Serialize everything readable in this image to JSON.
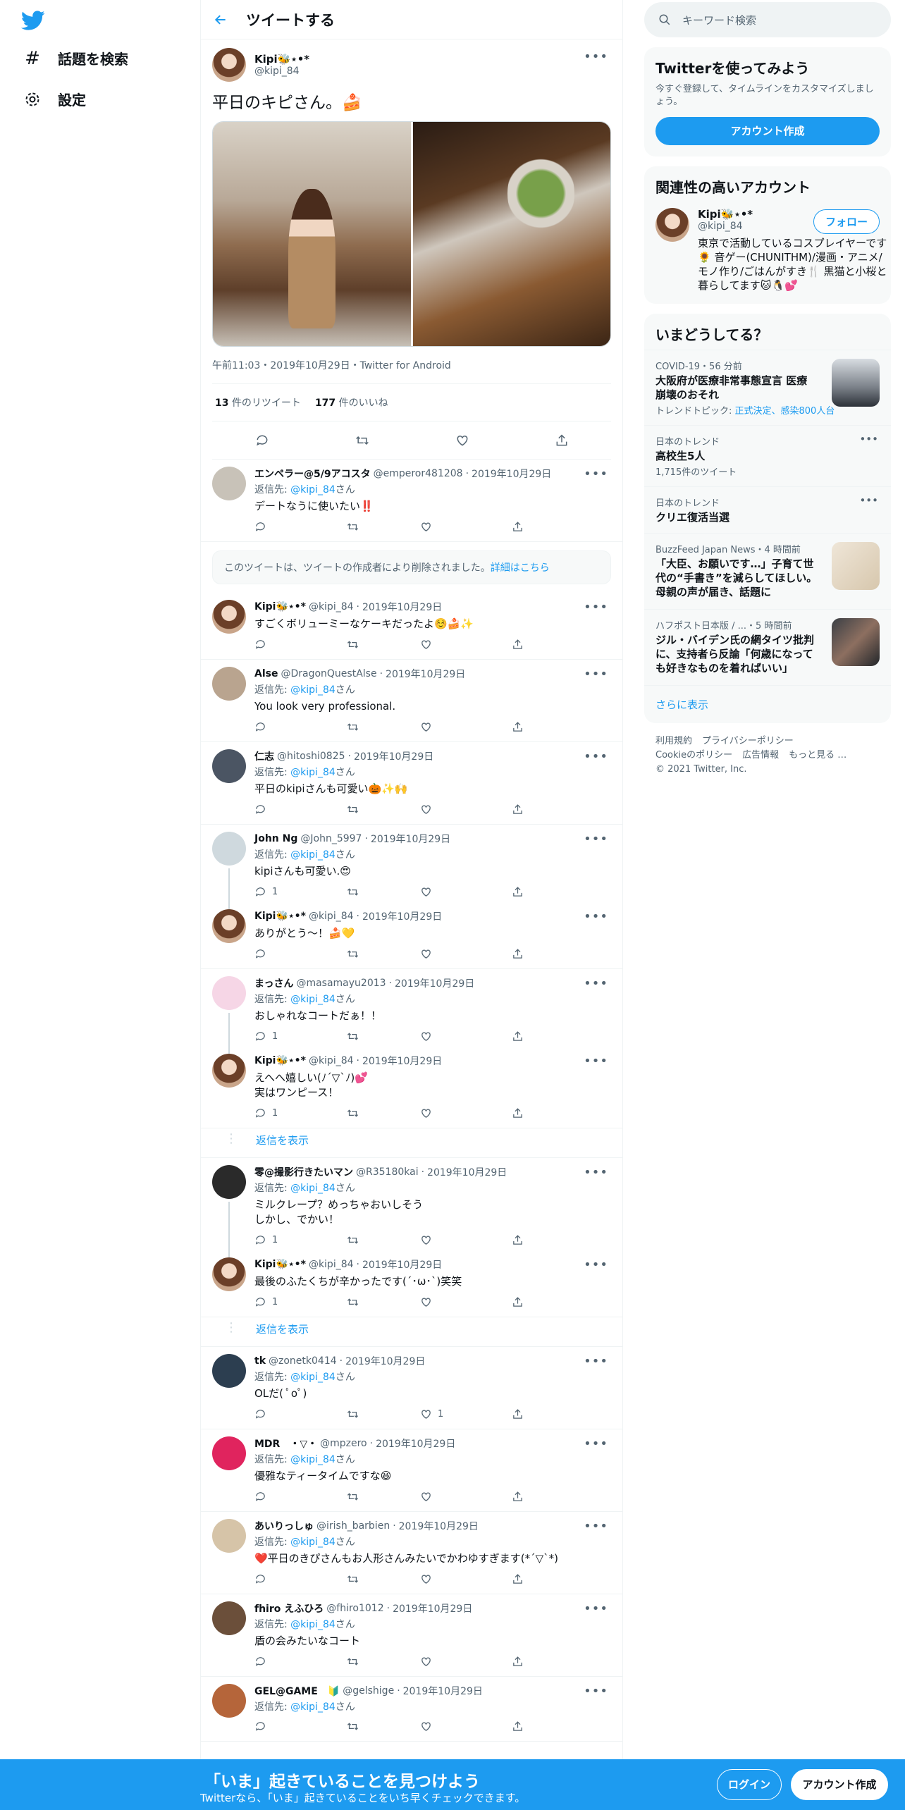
{
  "nav": {
    "explore_label": "話題を検索",
    "settings_label": "設定"
  },
  "header": {
    "title": "ツイートする"
  },
  "focal": {
    "name": "Kipi🐝⋆•*",
    "handle": "@kipi_84",
    "text": "平日のキピさん。🍰",
    "meta": "午前11:03・2019年10月29日・Twitter for Android",
    "retweets": "13",
    "retweets_label": "件のリツイート",
    "likes": "177",
    "likes_label": "件のいいね"
  },
  "deleted_notice": {
    "text": "このツイートは、ツイートの作成者により削除されました。",
    "link": "詳細はこちら"
  },
  "reply_to_label": "返信先:",
  "reply_to_suffix": "さん",
  "show_replies_label": "返信を表示",
  "replies": [
    {
      "name": "エンペラー@5/9アコスタ",
      "handle": "@emperor481208",
      "date": "2019年10月29日",
      "to": "@kipi_84",
      "text": "デートなうに使いたい‼️",
      "reply_count": "",
      "like_count": ""
    },
    {
      "name": "Kipi🐝⋆•*",
      "handle": "@kipi_84",
      "date": "2019年10月29日",
      "to": "",
      "text": "すごくボリューミーなケーキだったよ☺️🍰✨",
      "reply_count": "",
      "like_count": ""
    },
    {
      "name": "Alse",
      "handle": "@DragonQuestAlse",
      "date": "2019年10月29日",
      "to": "@kipi_84",
      "text": "You look very professional.",
      "reply_count": "",
      "like_count": ""
    },
    {
      "name": "仁志",
      "handle": "@hitoshi0825",
      "date": "2019年10月29日",
      "to": "@kipi_84",
      "text": "平日のkipiさんも可愛い🎃✨🙌",
      "reply_count": "",
      "like_count": ""
    },
    {
      "name": "John Ng",
      "handle": "@John_5997",
      "date": "2019年10月29日",
      "to": "@kipi_84",
      "text": "kipiさんも可愛い.😍",
      "reply_count": "1",
      "like_count": ""
    },
    {
      "name": "Kipi🐝⋆•*",
      "handle": "@kipi_84",
      "date": "2019年10月29日",
      "to": "",
      "text": "ありがとう〜！🍰💛",
      "reply_count": "",
      "like_count": ""
    },
    {
      "name": "まっさん",
      "handle": "@masamayu2013",
      "date": "2019年10月29日",
      "to": "@kipi_84",
      "text": "おしゃれなコートだぁ！！",
      "reply_count": "1",
      "like_count": ""
    },
    {
      "name": "Kipi🐝⋆•*",
      "handle": "@kipi_84",
      "date": "2019年10月29日",
      "to": "",
      "text": "えへへ嬉しい(ﾉ´▽`ﾉ)💕\n実はワンピース！",
      "reply_count": "1",
      "like_count": ""
    },
    {
      "name": "零@撮影行きたいマン",
      "handle": "@R35180kai",
      "date": "2019年10月29日",
      "to": "@kipi_84",
      "text": "ミルクレープ？めっちゃおいしそう\nしかし、でかい！",
      "reply_count": "1",
      "like_count": ""
    },
    {
      "name": "Kipi🐝⋆•*",
      "handle": "@kipi_84",
      "date": "2019年10月29日",
      "to": "",
      "text": "最後のふたくちが辛かったです(´･ω･`)笑笑",
      "reply_count": "1",
      "like_count": ""
    },
    {
      "name": "tk",
      "handle": "@zonetk0414",
      "date": "2019年10月29日",
      "to": "@kipi_84",
      "text": "OLだ( ﾟoﾟ)",
      "reply_count": "",
      "like_count": "1"
    },
    {
      "name": "MDR　・▽・",
      "handle": "@mpzero",
      "date": "2019年10月29日",
      "to": "@kipi_84",
      "text": "優雅なティータイムですな😆",
      "reply_count": "",
      "like_count": ""
    },
    {
      "name": "あいりっしゅ",
      "handle": "@irish_barbien",
      "date": "2019年10月29日",
      "to": "@kipi_84",
      "text": "❤️平日のきぴさんもお人形さんみたいでかわゆすぎます(*´▽`*)",
      "reply_count": "",
      "like_count": ""
    },
    {
      "name": "fhiro えふひろ",
      "handle": "@fhiro1012",
      "date": "2019年10月29日",
      "to": "@kipi_84",
      "text": "盾の会みたいなコート",
      "reply_count": "",
      "like_count": ""
    },
    {
      "name": "GEL@GAME　🔰",
      "handle": "@gelshige",
      "date": "2019年10月29日",
      "to": "@kipi_84",
      "text": "",
      "reply_count": "",
      "like_count": ""
    }
  ],
  "sidebar": {
    "search_placeholder": "キーワード検索",
    "signup_title": "Twitterを使ってみよう",
    "signup_sub": "今すぐ登録して、タイムラインをカスタマイズしましょう。",
    "signup_button": "アカウント作成",
    "related_title": "関連性の高いアカウント",
    "related": {
      "name": "Kipi🐝⋆•*",
      "handle": "@kipi_84",
      "follow": "フォロー",
      "bio": "東京で活動しているコスプレイヤーです🌻 音ゲー(CHUNITHM)/漫画・アニメ/モノ作り/ごはんがすき🍴 黒猫と小桜と暮らしてます🐱🐧💕"
    },
    "trends_title": "いまどうしてる？",
    "trends": [
      {
        "cat": "COVID-19・56 分前",
        "title": "大阪府が医療非常事態宣言 医療崩壊のおそれ",
        "sub_label": "トレンドトピック: ",
        "sub_links": "正式決定、感染800人台"
      },
      {
        "cat": "日本のトレンド",
        "title": "高校生5人",
        "sub": "1,715件のツイート"
      },
      {
        "cat": "日本のトレンド",
        "title": "クリエ復活当選",
        "sub": ""
      },
      {
        "cat": "BuzzFeed Japan News・4 時間前",
        "title": "「大臣、お願いです…」子育て世代の“手書き”を減らしてほしい。母親の声が届き、話題に"
      },
      {
        "cat": "ハフポスト日本版 / ...・5 時間前",
        "title": "ジル・バイデン氏の網タイツ批判に、支持者ら反論「何歳になっても好きなものを着ればいい」"
      }
    ],
    "show_more": "さらに表示",
    "footer": [
      "利用規約",
      "プライバシーポリシー",
      "Cookieのポリシー",
      "広告情報",
      "もっと見る …",
      "© 2021 Twitter, Inc."
    ]
  },
  "bottom_bar": {
    "title": "「いま」起きていることを見つけよう",
    "sub": "Twitterなら、「いま」起きていることをいち早くチェックできます。",
    "login": "ログイン",
    "signup": "アカウント作成"
  }
}
